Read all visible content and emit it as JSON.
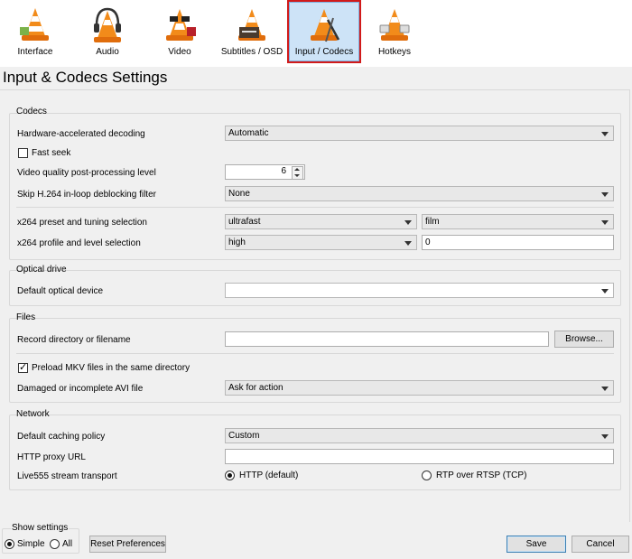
{
  "tabs": [
    {
      "label": "Interface",
      "icon": "cone-interface-icon"
    },
    {
      "label": "Audio",
      "icon": "cone-headphones-icon"
    },
    {
      "label": "Video",
      "icon": "cone-video-glasses-icon"
    },
    {
      "label": "Subtitles / OSD",
      "icon": "cone-subtitles-icon"
    },
    {
      "label": "Input / Codecs",
      "icon": "cone-codecs-icon",
      "active": true
    },
    {
      "label": "Hotkeys",
      "icon": "cone-hotkeys-icon"
    }
  ],
  "page_title": "Input & Codecs Settings",
  "codecs": {
    "group_label": "Codecs",
    "hw_decoding": {
      "label": "Hardware-accelerated decoding",
      "value": "Automatic"
    },
    "fast_seek": {
      "label": "Fast seek",
      "checked": false
    },
    "postproc": {
      "label": "Video quality post-processing level",
      "value": "6"
    },
    "skip_h264": {
      "label": "Skip H.264 in-loop deblocking filter",
      "value": "None"
    },
    "x264_preset": {
      "label": "x264 preset and tuning selection",
      "preset": "ultrafast",
      "tuning": "film"
    },
    "x264_profile": {
      "label": "x264 profile and level selection",
      "profile": "high",
      "level": "0"
    }
  },
  "optical": {
    "group_label": "Optical drive",
    "device": {
      "label": "Default optical device",
      "value": ""
    }
  },
  "files": {
    "group_label": "Files",
    "record": {
      "label": "Record directory or filename",
      "value": "",
      "browse": "Browse..."
    },
    "preload_mkv": {
      "label": "Preload MKV files in the same directory",
      "checked": true
    },
    "damaged_avi": {
      "label": "Damaged or incomplete AVI file",
      "value": "Ask for action"
    }
  },
  "network": {
    "group_label": "Network",
    "caching": {
      "label": "Default caching policy",
      "value": "Custom"
    },
    "proxy": {
      "label": "HTTP proxy URL",
      "value": ""
    },
    "live555": {
      "label": "Live555 stream transport",
      "opt_http": "HTTP (default)",
      "opt_rtsp": "RTP over RTSP (TCP)",
      "selected": "http"
    }
  },
  "footer": {
    "show_settings": "Show settings",
    "simple": "Simple",
    "all": "All",
    "selected": "simple",
    "reset": "Reset Preferences",
    "save": "Save",
    "cancel": "Cancel"
  }
}
